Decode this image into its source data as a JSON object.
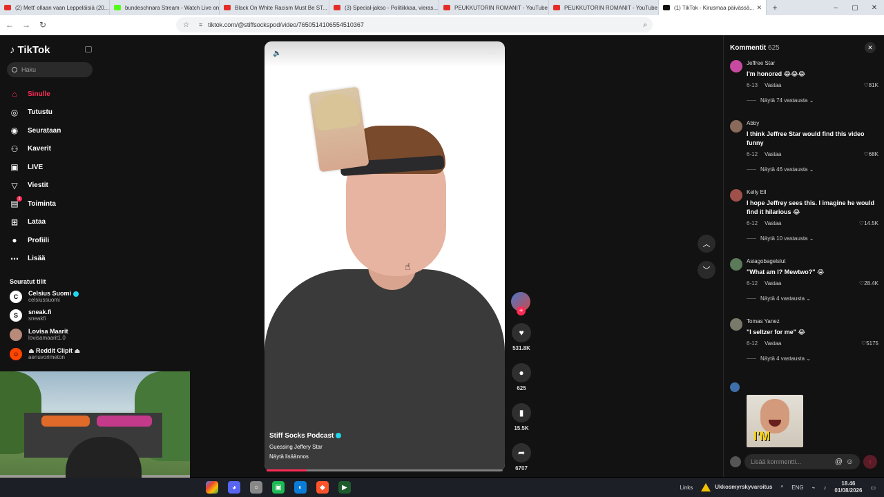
{
  "browser": {
    "tabs": [
      {
        "title": "(2) Mett' ollaan vaan Leppeläisiä (20...",
        "favicon_color": "#e52d27"
      },
      {
        "title": "bundeschnara Stream - Watch Live on ...",
        "favicon_color": "#53fc18"
      },
      {
        "title": "Black On White Racism Must Be ST...",
        "favicon_color": "#e52d27"
      },
      {
        "title": "(3) Special-jakso - Politiikkaa, vieras...",
        "favicon_color": "#e52d27"
      },
      {
        "title": "PEUKKUTORIN ROMANIT - YouTube",
        "favicon_color": "#e52d27"
      },
      {
        "title": "PEUKKUTORIN ROMANIT - YouTube",
        "favicon_color": "#e52d27"
      },
      {
        "title": "(1) TikTok - Kirusmaa päivässä...",
        "favicon_color": "#111111"
      }
    ],
    "new_tab_icon": "+",
    "url": "tiktok.com/@stiffsockspod/video/7650514106554510367"
  },
  "sidebar": {
    "logo_text": "TikTok",
    "search_placeholder": "Haku",
    "nav": [
      {
        "label": "Sinulle",
        "icon": "home-icon",
        "glyph": "⌂",
        "active": true
      },
      {
        "label": "Tutustu",
        "icon": "compass-icon",
        "glyph": "◎"
      },
      {
        "label": "Seurataan",
        "icon": "following-icon",
        "glyph": "◉"
      },
      {
        "label": "Kaverit",
        "icon": "friends-icon",
        "glyph": "⚇"
      },
      {
        "label": "LIVE",
        "icon": "live-icon",
        "glyph": "▣"
      },
      {
        "label": "Viestit",
        "icon": "messages-icon",
        "glyph": "▽"
      },
      {
        "label": "Toiminta",
        "icon": "activity-icon",
        "glyph": "▤",
        "badge": "1"
      },
      {
        "label": "Lataa",
        "icon": "upload-icon",
        "glyph": "⊞"
      },
      {
        "label": "Profiili",
        "icon": "profile-icon",
        "glyph": "●"
      },
      {
        "label": "Lisää",
        "icon": "more-icon",
        "glyph": "⋯"
      }
    ],
    "following_title": "Seuratut tilit",
    "following": [
      {
        "name": "Celsius Suomi",
        "handle": "celsiussuomi",
        "verified": true,
        "avatar_glyph": "C",
        "avatar_color": "#ffffff"
      },
      {
        "name": "sneak.fi",
        "handle": "sneakfi",
        "verified": false,
        "avatar_glyph": "S",
        "avatar_color": "#ffffff"
      },
      {
        "name": "Lovisa Maarit",
        "handle": "lovisamaarit1.0",
        "verified": false,
        "avatar_glyph": "",
        "avatar_color": "#b88a7a"
      },
      {
        "name": "⏏ Reddit Clipit ⏏",
        "handle": "aenuvorimeton",
        "verified": false,
        "avatar_glyph": "☺",
        "avatar_color": "#ff4500"
      }
    ]
  },
  "video": {
    "author": "Stiff Socks Podcast",
    "description": "Guessing Jeffery Star",
    "see_more": "Näytä lisäännos",
    "progress": 0.17
  },
  "actions": {
    "likes": "531.8K",
    "comments": "625",
    "saves": "15.5K",
    "shares": "6707"
  },
  "comments": {
    "title": "Kommentit",
    "count": "625",
    "reply_label": "Vastaa",
    "items": [
      {
        "user": "Jeffree Star",
        "text": "I'm honored 😂😂😂",
        "date": "6-13",
        "likes": "81K",
        "replies": "Näytä 74 vastausta",
        "avatar_color": "#c84aa0"
      },
      {
        "user": "Abby",
        "text": "I think Jeffree Star would find this video funny",
        "date": "6-12",
        "likes": "68K",
        "replies": "Näytä 46 vastausta",
        "avatar_color": "#8a6a5a"
      },
      {
        "user": "Kelly Ell",
        "text": "I hope Jeffrey sees this. I imagine he would find it hilarious 😂",
        "date": "6-12",
        "likes": "14.5K",
        "replies": "Näytä 10 vastausta",
        "avatar_color": "#a0504a"
      },
      {
        "user": "Asiagobagelslut",
        "text": "\"What am I? Mewtwo?\" 😭",
        "date": "6-12",
        "likes": "28.4K",
        "replies": "Näytä 4 vastausta",
        "avatar_color": "#5a7a5a"
      },
      {
        "user": "Tomas Yanez",
        "text": "\"I seltzer for me\" 😂",
        "date": "6-12",
        "likes": "5175",
        "replies": "Näytä 4 vastausta",
        "avatar_color": "#7a7a6a"
      }
    ],
    "gif_caption": "I'M",
    "input_placeholder": "Lisää kommentti..."
  },
  "taskbar": {
    "links_label": "Links",
    "weather_warning": "Ukkosmyrskyvaroitus",
    "lang": "ENG",
    "time": "18.46",
    "date": "01/08/2026"
  }
}
